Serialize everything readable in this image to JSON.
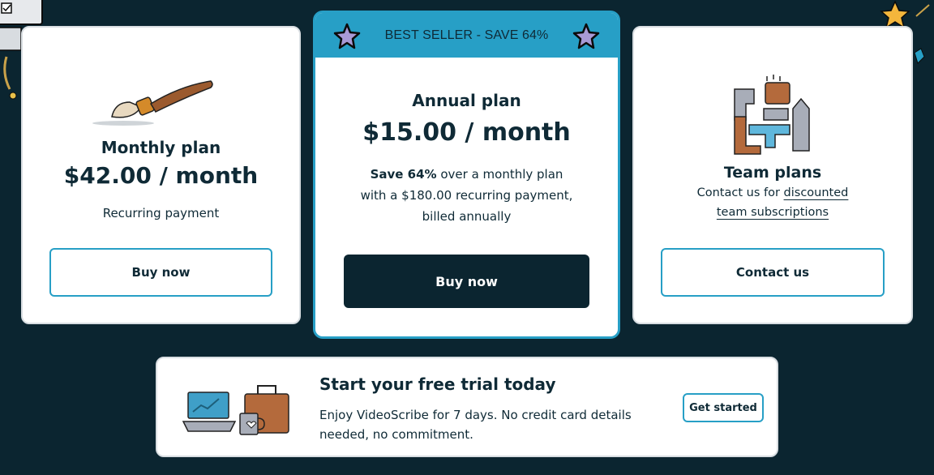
{
  "monthly": {
    "name": "Monthly plan",
    "price": "$42.00 / month",
    "note": "Recurring payment",
    "button": "Buy now",
    "icon": "paintbrush-icon"
  },
  "annual": {
    "banner": "BEST SELLER - SAVE 64%",
    "name": "Annual plan",
    "price": "$15.00 / month",
    "line1_bold": "Save 64%",
    "line1_rest": " over a monthly plan",
    "line2": "with a $180.00 recurring payment,",
    "line3": "billed annually",
    "button": "Buy now",
    "banner_icon": "star-icon"
  },
  "team": {
    "name": "Team plans",
    "line1_prefix": "Contact us for ",
    "link1": "discounted",
    "link2": "team subscriptions",
    "button": "Contact us",
    "icon": "building-blocks-icon"
  },
  "trial": {
    "title": "Start your free trial today",
    "body": "Enjoy VideoScribe for 7 days. No credit card details needed, no commitment.",
    "button": "Get started",
    "icon": "laptop-bag-mug-icon"
  },
  "colors": {
    "background": "#0b2530",
    "accent": "#279fc6",
    "card": "#ffffff",
    "text": "#0f2a36",
    "star": "#a99ad6"
  }
}
